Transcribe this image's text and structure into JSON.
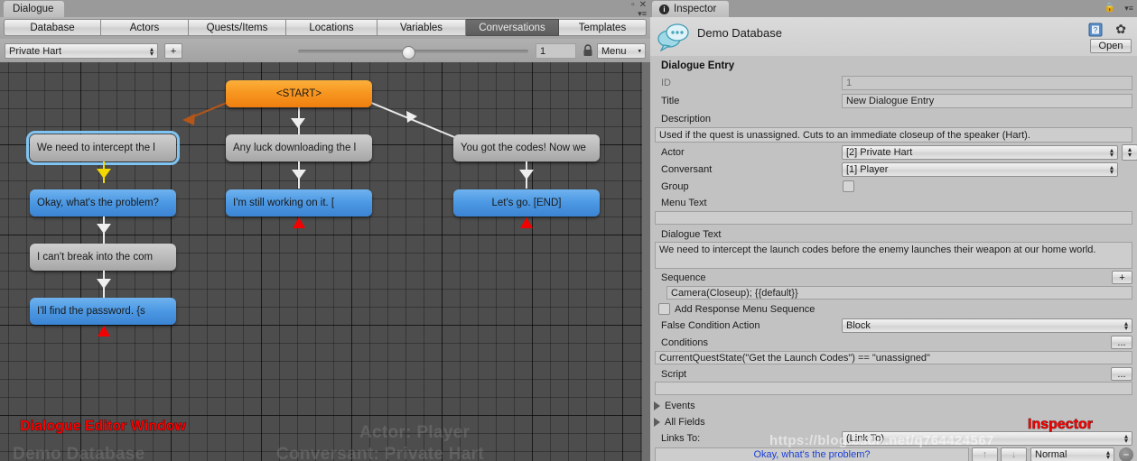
{
  "editor_window": {
    "tab_title": "Dialogue",
    "window_icons": {
      "maximize": "▫",
      "close": "✕",
      "menu": "▾≡"
    },
    "main_tabs": [
      {
        "label": "Database",
        "active": false
      },
      {
        "label": "Actors",
        "active": false
      },
      {
        "label": "Quests/Items",
        "active": false
      },
      {
        "label": "Locations",
        "active": false
      },
      {
        "label": "Variables",
        "active": false
      },
      {
        "label": "Conversations",
        "active": true
      },
      {
        "label": "Templates",
        "active": false
      }
    ],
    "subbar": {
      "conversation_selected": "Private Hart",
      "add_button_label": "+",
      "zoom_value": "1",
      "lock_icon": "lock-icon",
      "menu_label": "Menu"
    },
    "canvas": {
      "nodes": [
        {
          "id": "start",
          "label": "<START>",
          "type": "start"
        },
        {
          "id": "n1",
          "label": "We need to intercept the l",
          "type": "npc",
          "selected": true
        },
        {
          "id": "n2",
          "label": "Any luck downloading the l",
          "type": "npc"
        },
        {
          "id": "n3",
          "label": "You got the codes! Now we",
          "type": "npc"
        },
        {
          "id": "n4",
          "label": "Okay, what's the problem?",
          "type": "player"
        },
        {
          "id": "n5",
          "label": "I'm still working on it. [",
          "type": "player"
        },
        {
          "id": "n6",
          "label": "Let's go. [END]",
          "type": "player"
        },
        {
          "id": "n7",
          "label": "I can't break into the com",
          "type": "npc"
        },
        {
          "id": "n8",
          "label": "I'll find the password. {s",
          "type": "player"
        }
      ],
      "ghost_text": {
        "database": "Demo Database",
        "actor": "Actor: Player",
        "conversant": "Conversant: Private Hart"
      },
      "annotation": "Dialogue Editor Window"
    }
  },
  "inspector": {
    "tab_title": "Inspector",
    "tab_badge": "i",
    "database_name": "Demo Database",
    "open_button": "Open",
    "section_title": "Dialogue Entry",
    "annotation": "Inspector",
    "watermark": "https://blog.csdn.net/q764424567",
    "fields": {
      "id_label": "ID",
      "id_value": "1",
      "title_label": "Title",
      "title_value": "New Dialogue Entry",
      "description_label": "Description",
      "description_value": "Used if the quest is unassigned. Cuts to an immediate closeup of the speaker (Hart).",
      "actor_label": "Actor",
      "actor_value": "[2] Private Hart",
      "conversant_label": "Conversant",
      "conversant_value": "[1] Player",
      "group_label": "Group",
      "group_checked": false,
      "menu_text_label": "Menu Text",
      "menu_text_value": "",
      "dialogue_text_label": "Dialogue Text",
      "dialogue_text_value": "We need to intercept the launch codes before the enemy launches their weapon at our home world.",
      "sequence_label": "Sequence",
      "sequence_add": "+",
      "sequence_value": "Camera(Closeup); {{default}}",
      "add_response_menu_label": "Add Response Menu Sequence",
      "add_response_menu_checked": false,
      "false_condition_label": "False Condition Action",
      "false_condition_value": "Block",
      "conditions_label": "Conditions",
      "conditions_more": "...",
      "conditions_value": "CurrentQuestState(\"Get the Launch Codes\") == \"unassigned\"",
      "script_label": "Script",
      "script_more": "...",
      "script_value": "",
      "events_label": "Events",
      "all_fields_label": "All Fields",
      "links_to_label": "Links To:",
      "links_to_value": "(Link To)",
      "link_entry_label": "Okay, what's the problem?",
      "link_up": "↑",
      "link_down": "↓",
      "link_priority": "Normal",
      "link_remove": "–"
    }
  },
  "colors": {
    "npc_node": "#bdbdbd",
    "player_node": "#4e9ae4",
    "start_node": "#f79720",
    "selection": "#7fc4f2",
    "annotation_red": "#ff0000"
  }
}
